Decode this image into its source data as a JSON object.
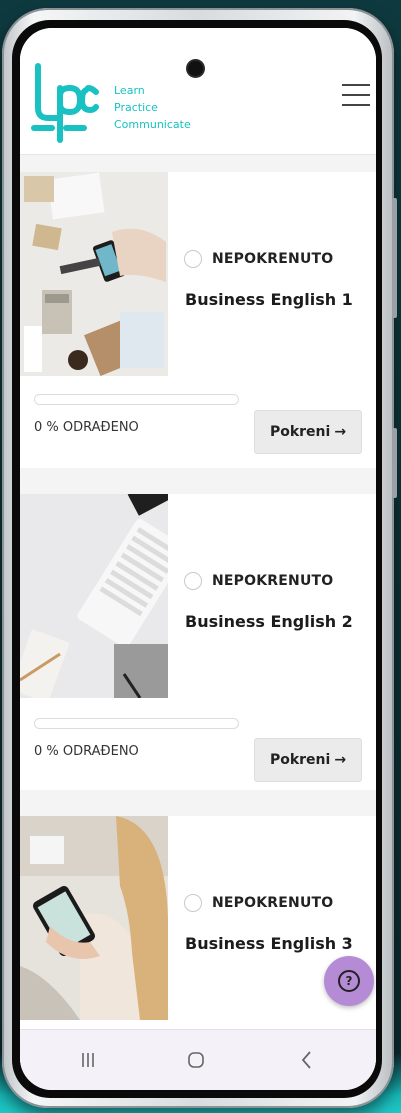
{
  "brand": {
    "logo_text": "lpc",
    "tagline": [
      "Learn",
      "Practice",
      "Communicate"
    ],
    "accent_color": "#19c1c2"
  },
  "header": {
    "menu_icon": "hamburger-menu-icon"
  },
  "courses": [
    {
      "status": "NEPOKRENUTO",
      "title": "Business English 1",
      "progress": 0,
      "progress_label": "0 % ODRAĐENO",
      "button_label": "Pokreni",
      "button_icon": "→"
    },
    {
      "status": "NEPOKRENUTO",
      "title": "Business English 2",
      "progress": 0,
      "progress_label": "0 % ODRAĐENO",
      "button_label": "Pokreni",
      "button_icon": "→"
    },
    {
      "status": "NEPOKRENUTO",
      "title": "Business English 3"
    }
  ],
  "help": {
    "icon": "question-icon",
    "symbol": "?",
    "color": "#b58bd6"
  },
  "system_nav": {
    "recents": "|||",
    "home": "○",
    "back": "‹"
  }
}
